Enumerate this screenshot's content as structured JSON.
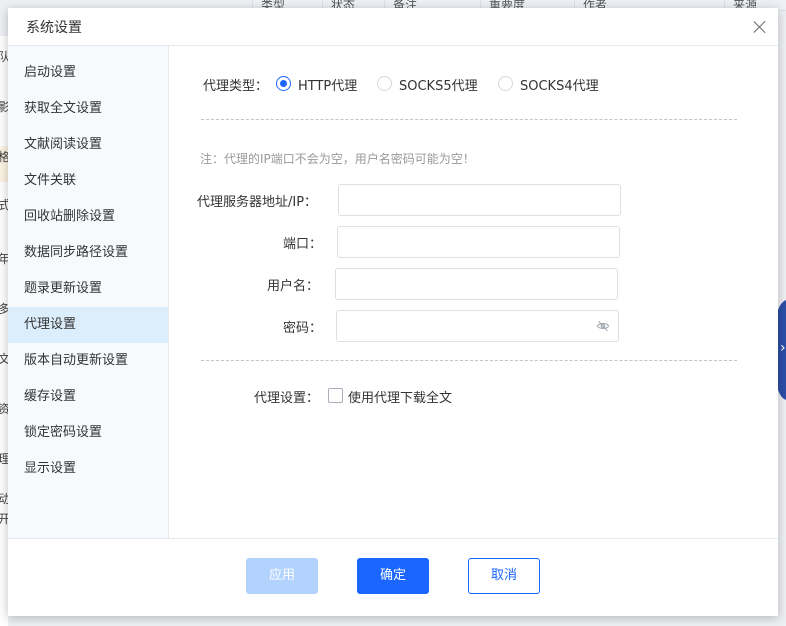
{
  "background": {
    "columns": [
      "类型",
      "状态",
      "备注",
      "重要度",
      "作者",
      "来源"
    ],
    "left_fragments": [
      "队",
      "影",
      "格",
      "式",
      "年",
      "多",
      "文",
      "资",
      "理",
      "动",
      "开"
    ]
  },
  "dialog": {
    "title": "系统设置",
    "close_icon": "close-icon"
  },
  "sidebar": {
    "items": [
      {
        "label": "启动设置"
      },
      {
        "label": "获取全文设置"
      },
      {
        "label": "文献阅读设置"
      },
      {
        "label": "文件关联"
      },
      {
        "label": "回收站删除设置"
      },
      {
        "label": "数据同步路径设置"
      },
      {
        "label": "题录更新设置"
      },
      {
        "label": "代理设置",
        "active": true
      },
      {
        "label": "版本自动更新设置"
      },
      {
        "label": "缓存设置"
      },
      {
        "label": "锁定密码设置"
      },
      {
        "label": "显示设置"
      }
    ]
  },
  "proxy": {
    "type_label": "代理类型：",
    "options": [
      {
        "label": "HTTP代理",
        "checked": true
      },
      {
        "label": "SOCKS5代理",
        "checked": false
      },
      {
        "label": "SOCKS4代理",
        "checked": false
      }
    ],
    "note": "注：代理的IP端口不会为空，用户名密码可能为空！",
    "fields": {
      "server_label": "代理服务器地址/IP：",
      "server_value": "",
      "port_label": "端口：",
      "port_value": "",
      "username_label": "用户名：",
      "username_value": "",
      "password_label": "密码：",
      "password_value": "",
      "password_icon": "eye-off-icon"
    },
    "setting_label": "代理设置：",
    "download_checkbox_label": "使用代理下载全文",
    "download_checked": false
  },
  "footer": {
    "apply": "应用",
    "ok": "确定",
    "cancel": "取消"
  },
  "colors": {
    "accent": "#1a66ff",
    "apply_disabled": "#b3d3ff",
    "sidebar_active": "#dceefb",
    "sidebar_bg": "#f7fafd"
  }
}
